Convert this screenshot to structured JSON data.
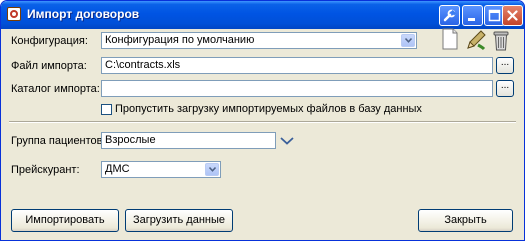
{
  "window": {
    "title": "Импорт договоров",
    "icons": [
      "app-icon",
      "tools-icon",
      "minimize-icon",
      "maximize-icon",
      "close-icon"
    ]
  },
  "form": {
    "config_label": "Конфигурация:",
    "config_value": "Конфигурация по умолчанию",
    "import_file_label": "Файл импорта:",
    "import_file_value": "C:\\contracts.xls",
    "import_dir_label": "Каталог импорта:",
    "import_dir_value": "",
    "browse_label": "...",
    "skip_checkbox_label": "Пропустить загрузку импортируемых файлов в базу данных",
    "skip_checked": false,
    "patient_group_label": "Группа пациентов:",
    "patient_group_value": "Взрослые",
    "price_list_label": "Прейскурант:",
    "price_list_value": "ДМС"
  },
  "config_tools": [
    "new-document-icon",
    "edit-pencil-icon",
    "delete-trash-icon"
  ],
  "buttons": {
    "import": "Импортировать",
    "load_data": "Загрузить данные",
    "close": "Закрыть"
  }
}
